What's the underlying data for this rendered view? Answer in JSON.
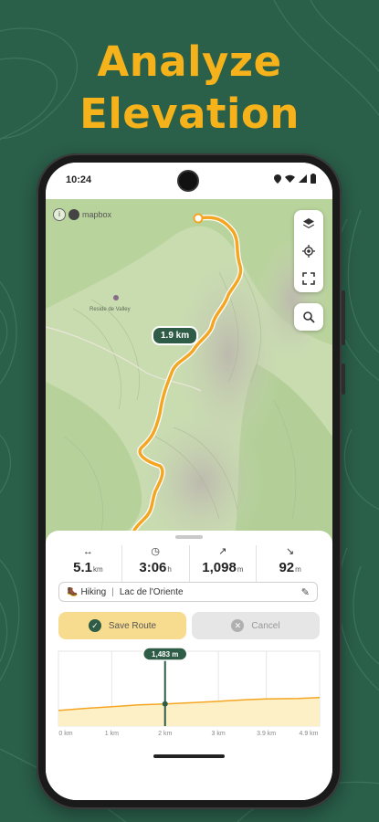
{
  "headline": {
    "line1": "Analyze",
    "line2": "Elevation"
  },
  "colors": {
    "background": "#2a5f4a",
    "headline": "#f5b21a",
    "route": "#f4a623",
    "brand_green": "#2e5c46",
    "save_bg": "#f7dc90"
  },
  "status_bar": {
    "time": "10:24"
  },
  "map": {
    "attribution": "mapbox",
    "distance_chip": "1.9 km",
    "place_label": "Reside de Valley",
    "controls": [
      "layers-icon",
      "locate-icon",
      "expand-icon",
      "search-icon"
    ]
  },
  "stats": [
    {
      "icon": "↔",
      "value": "5.1",
      "unit": "km"
    },
    {
      "icon": "◷",
      "value": "3:06",
      "unit": "h"
    },
    {
      "icon": "↗",
      "value": "1,098",
      "unit": "m"
    },
    {
      "icon": "↘",
      "value": "92",
      "unit": "m"
    }
  ],
  "route_meta": {
    "activity": "Hiking",
    "name": "Lac de l'Oriente"
  },
  "actions": {
    "save": "Save Route",
    "cancel": "Cancel"
  },
  "chart_data": {
    "type": "area",
    "x": [
      0,
      0.5,
      1,
      1.5,
      2,
      2.5,
      3,
      3.5,
      3.9,
      4.5,
      4.9
    ],
    "y": [
      1040,
      1180,
      1290,
      1420,
      1483,
      1560,
      1650,
      1760,
      1820,
      1850,
      1900
    ],
    "x_tick_labels": [
      "0 km",
      "1 km",
      "2 km",
      "3 km",
      "3.9 km",
      "4.9 km"
    ],
    "x_ticks": [
      0,
      1,
      2,
      3,
      3.9,
      4.9
    ],
    "xlim": [
      0,
      4.9
    ],
    "ylim": [
      0,
      5000
    ],
    "cursor": {
      "x": 2,
      "label": "1,483 m"
    },
    "grid": true
  }
}
